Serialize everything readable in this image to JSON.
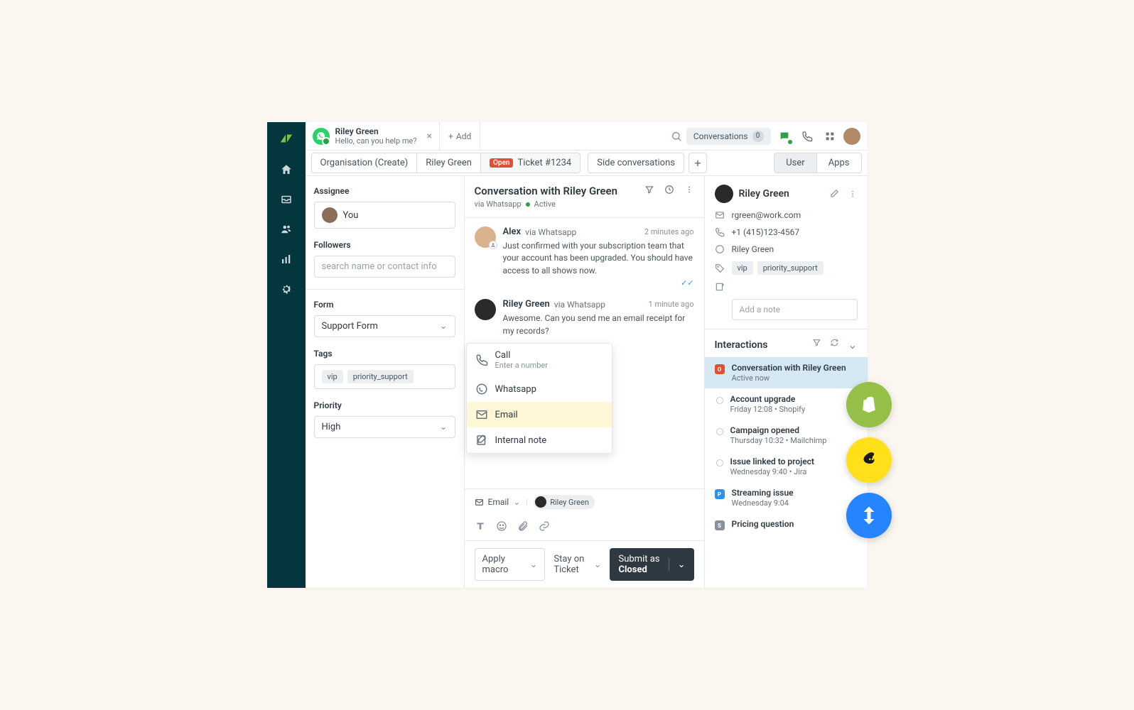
{
  "tab": {
    "name": "Riley Green",
    "subtitle": "Hello, can you help me?",
    "add_label": "Add"
  },
  "toprow": {
    "conversations_label": "Conversations",
    "conversations_count": "0"
  },
  "breadcrumbs": {
    "org": "Organisation (Create)",
    "user": "Riley Green",
    "ticket_badge": "Open",
    "ticket": "Ticket #1234",
    "side_conv": "Side conversations"
  },
  "ua": {
    "user": "User",
    "apps": "Apps"
  },
  "left": {
    "assignee_label": "Assignee",
    "assignee_value": "You",
    "followers_label": "Followers",
    "followers_placeholder": "search name or contact info",
    "form_label": "Form",
    "form_value": "Support Form",
    "tags_label": "Tags",
    "tags": [
      "vip",
      "priority_support"
    ],
    "priority_label": "Priority",
    "priority_value": "High"
  },
  "conv": {
    "title": "Conversation with Riley Green",
    "via": "via Whatsapp",
    "status": "Active",
    "messages": [
      {
        "author": "Alex",
        "via": "via Whatsapp",
        "time": "2 minutes ago",
        "text": "Just confirmed with your subscription team that your account has been upgraded. You should have access to all shows now."
      },
      {
        "author": "Riley Green",
        "via": "via Whatsapp",
        "time": "1 minute ago",
        "text": "Awesome. Can you send me an email receipt for my records?"
      }
    ]
  },
  "channels": {
    "call": "Call",
    "call_sub": "Enter a number",
    "whatsapp": "Whatsapp",
    "email": "Email",
    "note": "Internal note"
  },
  "composer": {
    "channel": "Email",
    "to": "Riley Green"
  },
  "footer": {
    "macro": "Apply macro",
    "stay": "Stay on Ticket",
    "submit_pre": "Submit as ",
    "submit_state": "Closed"
  },
  "right": {
    "name": "Riley Green",
    "email": "rgreen@work.com",
    "phone": "+1 (415)123-4567",
    "whatsapp": "Riley Green",
    "tags": [
      "vip",
      "priority_support"
    ],
    "note_placeholder": "Add a note"
  },
  "interactions": {
    "title": "Interactions",
    "items": [
      {
        "badge": "O",
        "title": "Conversation with Riley Green",
        "sub": "Active now"
      },
      {
        "badge": "ring",
        "title": "Account upgrade",
        "sub": "Friday 12:08 • Shopify"
      },
      {
        "badge": "ring",
        "title": "Campaign opened",
        "sub": "Thursday 10:32 • Mailchimp"
      },
      {
        "badge": "ring",
        "title": "Issue linked to project",
        "sub": "Wednesday 9:40 • Jira"
      },
      {
        "badge": "P",
        "title": "Streaming issue",
        "sub": "Wednesday 9:04"
      },
      {
        "badge": "S",
        "title": "Pricing question",
        "sub": ""
      }
    ]
  }
}
